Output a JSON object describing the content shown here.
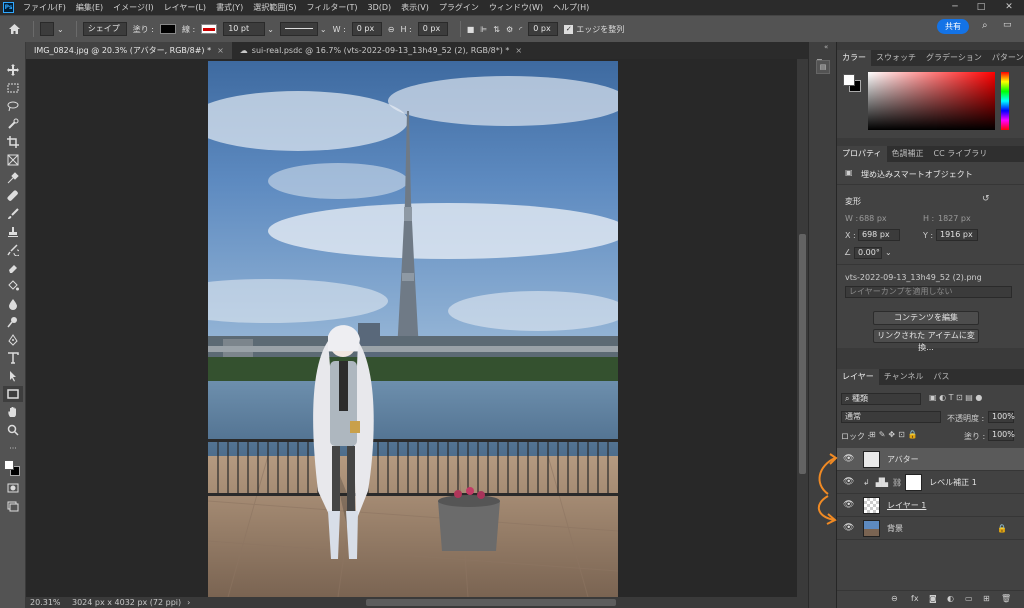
{
  "menubar": {
    "items": [
      "ファイル(F)",
      "編集(E)",
      "イメージ(I)",
      "レイヤー(L)",
      "書式(Y)",
      "選択範囲(S)",
      "フィルター(T)",
      "3D(D)",
      "表示(V)",
      "プラグイン",
      "ウィンドウ(W)",
      "ヘルプ(H)"
    ]
  },
  "options": {
    "shape_mode": "シェイプ",
    "fill_label": "塗り :",
    "stroke_label": "線 :",
    "stroke_width": "10 pt",
    "w_label": "W :",
    "w_value": "0 px",
    "h_label": "H :",
    "h_value": "0 px",
    "radius": "0 px",
    "align_edges": "エッジを整列",
    "share": "共有"
  },
  "tabs": [
    {
      "label": "IMG_0824.jpg @ 20.3% (アバター, RGB/8#) *"
    },
    {
      "label": "sui-real.psdc @ 16.7% (vts-2022-09-13_13h49_52 (2), RGB/8*) *"
    }
  ],
  "status": {
    "zoom": "20.31%",
    "doc_info": "3024 px x 4032 px (72 ppi)"
  },
  "color_panel": {
    "tabs": [
      "カラー",
      "スウォッチ",
      "グラデーション",
      "パターン"
    ]
  },
  "props_panel": {
    "tabs": [
      "プロパティ",
      "色調補正",
      "CC ライブラリ"
    ],
    "object_type": "埋め込みスマートオブジェクト",
    "transform_label": "変形",
    "w_label": "W :",
    "w_value": "688 px",
    "h_label": "H :",
    "h_value": "1827 px",
    "x_label": "X :",
    "x_value": "698 px",
    "y_label": "Y :",
    "y_value": "1916 px",
    "angle": "0.00°",
    "filename": "vts-2022-09-13_13h49_52 (2).png",
    "comp_placeholder": "レイヤーカンプを適用しない",
    "edit_button": "コンテンツを編集",
    "convert_button": "リンクされた アイテムに変換..."
  },
  "layers_panel": {
    "tabs": [
      "レイヤー",
      "チャンネル",
      "パス"
    ],
    "filter_kind": "種類",
    "blend_mode": "通常",
    "opacity_label": "不透明度 :",
    "opacity": "100%",
    "lock_label": "ロック :",
    "fill_label": "塗り :",
    "fill": "100%",
    "layers": [
      {
        "name": "アバター",
        "visible": true,
        "selected": true
      },
      {
        "name": "レベル補正 1",
        "visible": true,
        "selected": false
      },
      {
        "name": "レイヤー 1",
        "visible": true,
        "selected": false
      },
      {
        "name": "背景",
        "visible": true,
        "selected": false
      }
    ]
  },
  "colors": {
    "accent": "#1473e6",
    "annotation": "#f08a24",
    "fg_swatch": "#ffffff",
    "bg_swatch": "#000000"
  }
}
